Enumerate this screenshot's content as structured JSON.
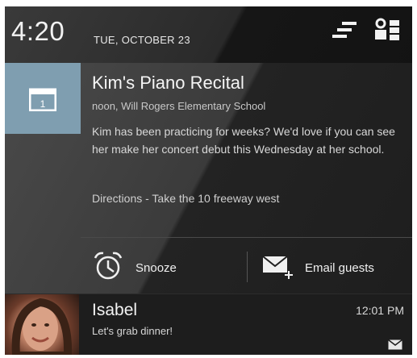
{
  "status": {
    "time": "4:20",
    "date": "TUE, OCTOBER 23",
    "icons": [
      "clear-all-icon",
      "quick-settings-icon"
    ]
  },
  "event": {
    "icon": "calendar-icon",
    "calendar_day": "1",
    "title": "Kim's Piano Recital",
    "subtitle": "noon, Will Rogers Elementary School",
    "body": "Kim has been practicing for weeks? We'd love if you can see her make her concert debut this Wednesday at her school.",
    "directions": "Directions - Take the 10 freeway west",
    "actions": [
      {
        "label": "Snooze",
        "icon": "alarm-clock-icon"
      },
      {
        "label": "Email guests",
        "icon": "email-add-icon"
      }
    ]
  },
  "message": {
    "name": "Isabel",
    "text": "Let's grab dinner!",
    "time": "12:01 PM",
    "icon": "mail-icon"
  }
}
